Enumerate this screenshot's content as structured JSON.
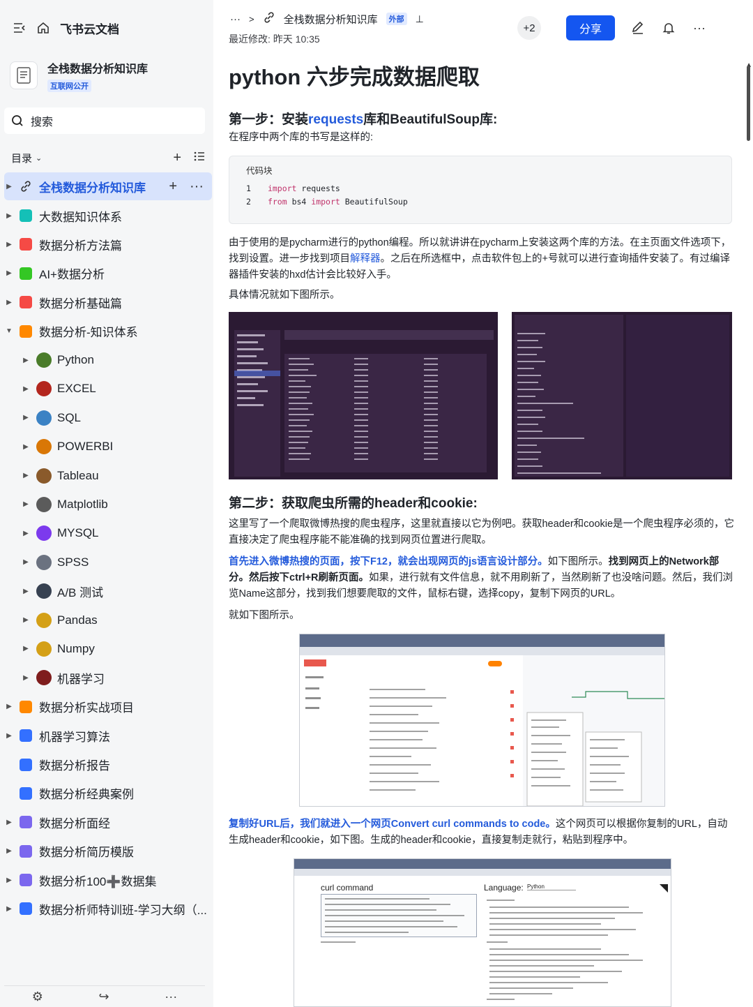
{
  "app": {
    "name": "飞书云文档"
  },
  "knowledge_base": {
    "title": "全栈数据分析知识库",
    "badge": "互联网公开"
  },
  "search": {
    "placeholder": "搜索"
  },
  "toc": {
    "label": "目录"
  },
  "tree": [
    {
      "label": "全栈数据分析知识库",
      "active": true,
      "icon": "link-icon",
      "color": "#245bdb",
      "level": 1
    },
    {
      "label": "大数据知识体系",
      "icon": "diamond-icon",
      "color": "#14c0b7",
      "level": 1
    },
    {
      "label": "数据分析方法篇",
      "icon": "book-icon",
      "color": "#f54a45",
      "level": 1
    },
    {
      "label": "AI+数据分析",
      "icon": "home-icon",
      "color": "#34c724",
      "level": 1
    },
    {
      "label": "数据分析基础篇",
      "icon": "book-icon",
      "color": "#f54a45",
      "level": 1
    },
    {
      "label": "数据分析-知识体系",
      "icon": "folder-icon",
      "color": "#ff8800",
      "level": 1,
      "expanded": true
    },
    {
      "label": "Python",
      "icon": "python-icon",
      "color": "#4a7c2a",
      "level": 2
    },
    {
      "label": "EXCEL",
      "icon": "bug-icon",
      "color": "#b3261e",
      "level": 2
    },
    {
      "label": "SQL",
      "icon": "nodes-icon",
      "color": "#3b82c4",
      "level": 2
    },
    {
      "label": "POWERBI",
      "icon": "pencil-icon",
      "color": "#d97706",
      "level": 2
    },
    {
      "label": "Tableau",
      "icon": "box-icon",
      "color": "#8a5a2b",
      "level": 2
    },
    {
      "label": "Matplotlib",
      "icon": "chart-icon",
      "color": "#5b5b5b",
      "level": 2
    },
    {
      "label": "MYSQL",
      "icon": "db-icon",
      "color": "#7c3aed",
      "level": 2
    },
    {
      "label": "SPSS",
      "icon": "tool-icon",
      "color": "#6b7280",
      "level": 2
    },
    {
      "label": "A/B 测试",
      "icon": "page-icon",
      "color": "#374151",
      "level": 2
    },
    {
      "label": "Pandas",
      "icon": "cup-icon",
      "color": "#d4a017",
      "level": 2
    },
    {
      "label": "Numpy",
      "icon": "key-icon",
      "color": "#d4a017",
      "level": 2
    },
    {
      "label": "机器学习",
      "icon": "skier-icon",
      "color": "#7f1d1d",
      "level": 2
    },
    {
      "label": "数据分析实战项目",
      "icon": "folder-icon",
      "color": "#ff8800",
      "level": 1
    },
    {
      "label": "机器学习算法",
      "icon": "doc-icon",
      "color": "#3370ff",
      "level": 1
    },
    {
      "label": "数据分析报告",
      "icon": "doc-icon",
      "color": "#3370ff",
      "level": 1,
      "no_arrow": true
    },
    {
      "label": "数据分析经典案例",
      "icon": "doc-icon",
      "color": "#3370ff",
      "level": 1,
      "no_arrow": true
    },
    {
      "label": "数据分析面经",
      "icon": "list-icon",
      "color": "#7b67ee",
      "level": 1
    },
    {
      "label": "数据分析简历模版",
      "icon": "list-icon",
      "color": "#7b67ee",
      "level": 1
    },
    {
      "label": "数据分析100➕数据集",
      "icon": "list-icon",
      "color": "#7b67ee",
      "level": 1
    },
    {
      "label": "数据分析师特训班-学习大纲（...",
      "icon": "clock-icon",
      "color": "#3370ff",
      "level": 1
    }
  ],
  "header": {
    "more": "···",
    "title": "全栈数据分析知识库",
    "tag": "外部",
    "last_modified": "最近修改: 昨天 10:35",
    "collaborators": "+2",
    "share": "分享"
  },
  "doc": {
    "title": "python 六步完成数据爬取",
    "step1": {
      "heading_pre": "第一步：安装",
      "heading_blue": "requests",
      "heading_post": "库和BeautifulSoup库:",
      "intro": "在程序中两个库的书写是这样的:",
      "code_label": "代码块",
      "code": [
        {
          "n": "1",
          "kw": "import",
          "rest": " requests"
        },
        {
          "n": "2",
          "kw": "from",
          "rest": " bs4 ",
          "kw2": "import",
          "rest2": " BeautifulSoup"
        }
      ],
      "para1_a": "由于使用的是pycharm进行的python编程。所以就讲讲在pycharm上安装这两个库的方法。在主页面文件选项下，找到设置。进一步找到项目",
      "para1_link": "解释器",
      "para1_b": "。之后在所选框中，点击软件包上的+号就可以进行查询插件安装了。有过编译器插件安装的hxd估计会比较好入手。",
      "para2": "具体情况就如下图所示。"
    },
    "step2": {
      "heading": "第二步：获取爬虫所需的header和cookie:",
      "para1": "这里写了一个爬取微博热搜的爬虫程序，这里就直接以它为例吧。获取header和cookie是一个爬虫程序必须的，它直接决定了爬虫程序能不能准确的找到网页位置进行爬取。",
      "para2_blue": "首先进入微博热搜的页面，按下F12，就会出现网页的js语言设计部分。",
      "para2_a": "如下图所示。",
      "para2_bold": "找到网页上的Network部分。然后按下ctrl+R刷新页面。",
      "para2_b": "如果，进行就有文件信息，就不用刷新了，当然刷新了也没啥问题。然后，我们浏览Name这部分，找到我们想要爬取的文件，鼠标右键，选择copy，复制下网页的URL。",
      "para3": "就如下图所示。",
      "para4_blue": "复制好URL后，我们就进入一个网页Convert curl commands to code。",
      "para4": "这个网页可以根据你复制的URL，自动生成header和cookie，如下图。生成的header和cookie，直接复制走就行，粘贴到程序中。",
      "curl_label": "curl command",
      "lang_label": "Language:",
      "lang_value": "Python"
    }
  }
}
